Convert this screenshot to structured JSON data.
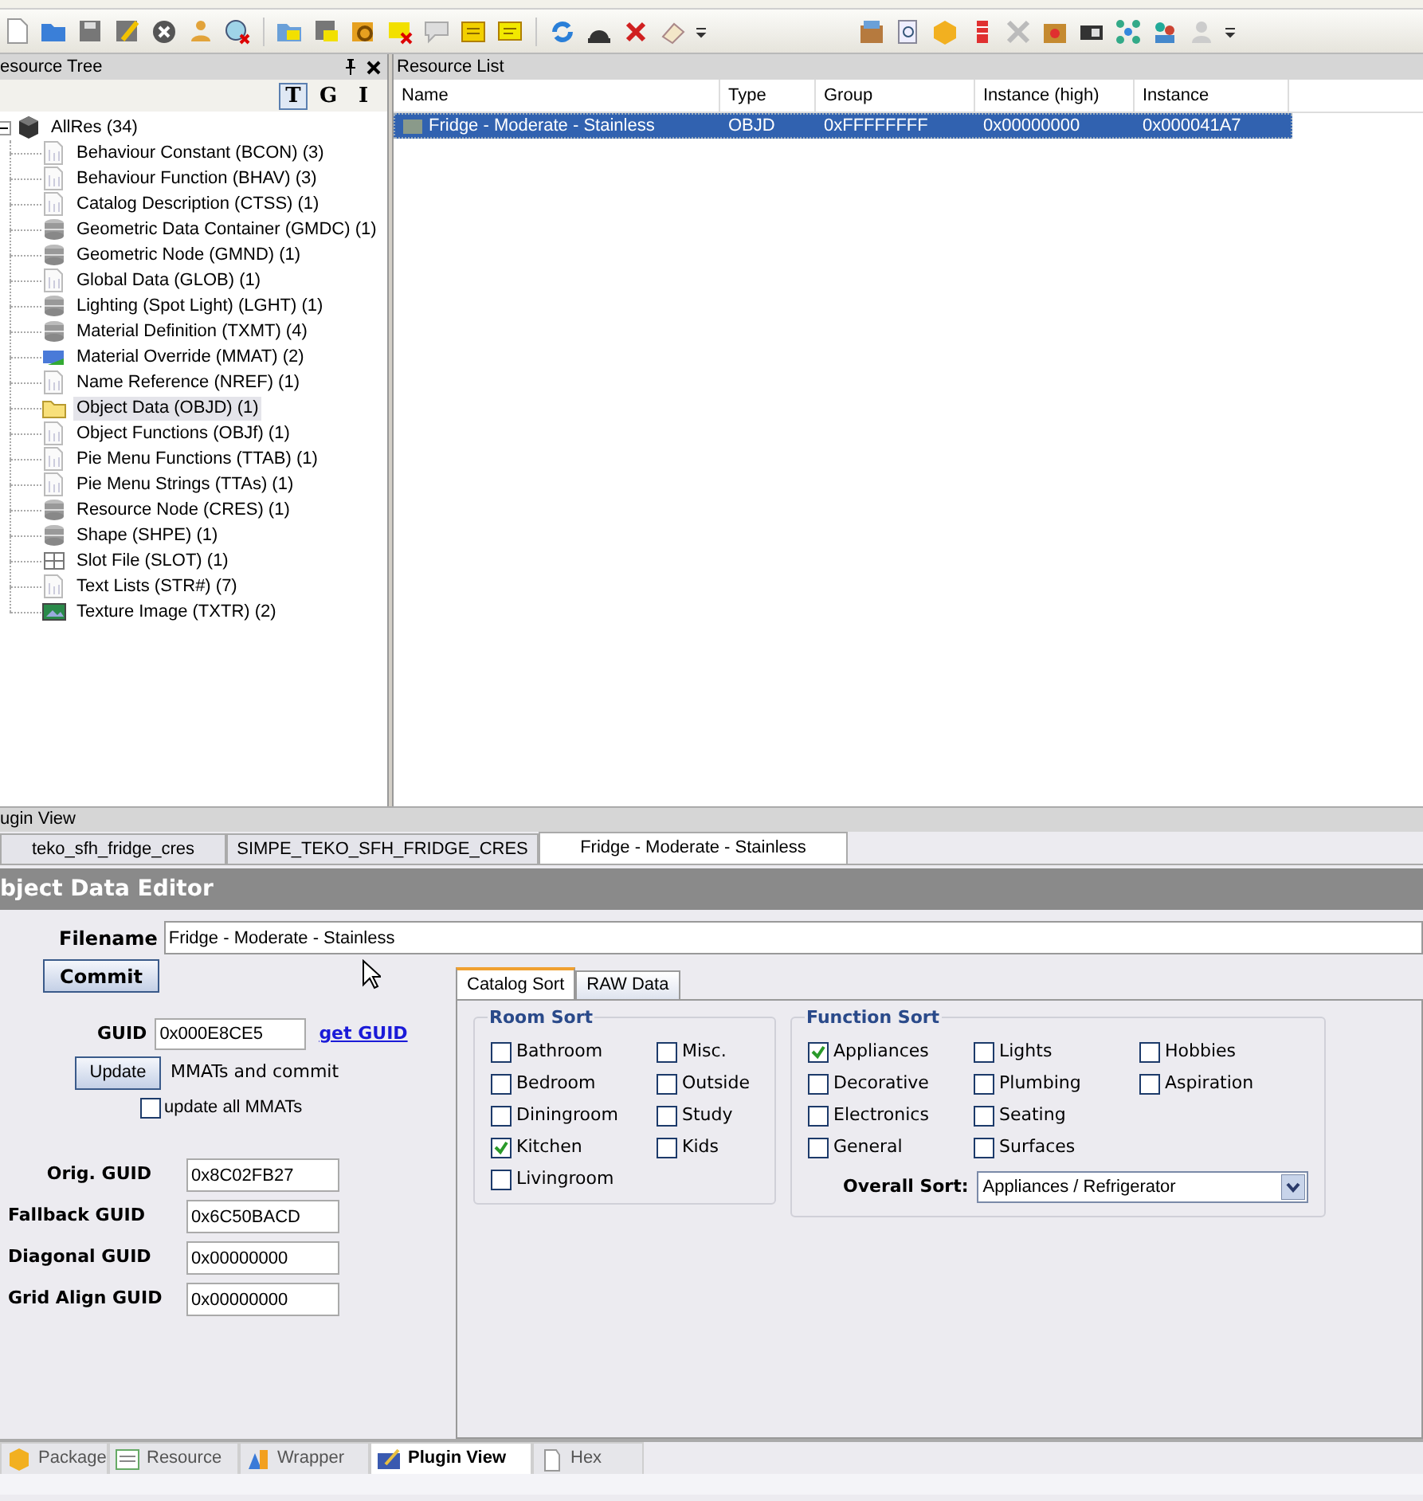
{
  "resource_tree": {
    "title": "esource Tree",
    "view_buttons": [
      {
        "label": "T",
        "selected": true
      },
      {
        "label": "G",
        "selected": false
      },
      {
        "label": "I",
        "selected": false
      }
    ],
    "root": {
      "label": "AllRes (34)",
      "expanded": true,
      "children": [
        {
          "label": "Behaviour Constant (BCON) (3)",
          "kind": "doc",
          "selected": false
        },
        {
          "label": "Behaviour Function (BHAV) (3)",
          "kind": "doc",
          "selected": false
        },
        {
          "label": "Catalog Description (CTSS) (1)",
          "kind": "doc",
          "selected": false
        },
        {
          "label": "Geometric Data Container (GMDC) (1)",
          "kind": "db",
          "selected": false
        },
        {
          "label": "Geometric Node (GMND) (1)",
          "kind": "db",
          "selected": false
        },
        {
          "label": "Global Data (GLOB) (1)",
          "kind": "doc",
          "selected": false
        },
        {
          "label": "Lighting (Spot Light) (LGHT) (1)",
          "kind": "db",
          "selected": false
        },
        {
          "label": "Material Definition (TXMT) (4)",
          "kind": "db",
          "selected": false
        },
        {
          "label": "Material Override (MMAT) (2)",
          "kind": "material",
          "selected": false
        },
        {
          "label": "Name Reference (NREF) (1)",
          "kind": "doc",
          "selected": false
        },
        {
          "label": "Object Data (OBJD) (1)",
          "kind": "folder",
          "selected": true
        },
        {
          "label": "Object Functions (OBJf) (1)",
          "kind": "doc",
          "selected": false
        },
        {
          "label": "Pie Menu Functions (TTAB) (1)",
          "kind": "doc",
          "selected": false
        },
        {
          "label": "Pie Menu Strings (TTAs) (1)",
          "kind": "doc",
          "selected": false
        },
        {
          "label": "Resource Node (CRES) (1)",
          "kind": "db",
          "selected": false
        },
        {
          "label": "Shape (SHPE) (1)",
          "kind": "db",
          "selected": false
        },
        {
          "label": "Slot File (SLOT) (1)",
          "kind": "slot",
          "selected": false
        },
        {
          "label": "Text Lists (STR#) (7)",
          "kind": "doc",
          "selected": false
        },
        {
          "label": "Texture Image (TXTR) (2)",
          "kind": "image",
          "selected": false
        }
      ]
    }
  },
  "resource_list": {
    "title": "Resource List",
    "columns": [
      "Name",
      "Type",
      "Group",
      "Instance (high)",
      "Instance"
    ],
    "rows": [
      {
        "cells": [
          "Fridge - Moderate - Stainless",
          "OBJD",
          "0xFFFFFFFF",
          "0x00000000",
          "0x000041A7"
        ],
        "selected": true
      }
    ]
  },
  "plugin_view": {
    "title": "ugin View",
    "doc_tabs": [
      {
        "label": "teko_sfh_fridge_cres",
        "selected": false
      },
      {
        "label": "SIMPE_TEKO_SFH_FRIDGE_CRES",
        "selected": false
      },
      {
        "label": "Fridge - Moderate - Stainless",
        "selected": true
      }
    ],
    "editor": {
      "title": "bject Data Editor",
      "filename_label": "Filename",
      "filename": "Fridge - Moderate - Stainless",
      "commit": "Commit",
      "guid_label": "GUID",
      "guid": "0x000E8CE5",
      "get_guid": "get GUID",
      "update": "Update",
      "update_text": "MMATs and commit",
      "update_all": {
        "label": "update all MMATs",
        "checked": false
      },
      "guids": [
        {
          "label": "Orig. GUID",
          "value": "0x8C02FB27"
        },
        {
          "label": "Fallback GUID",
          "value": "0x6C50BACD"
        },
        {
          "label": "Diagonal GUID",
          "value": "0x00000000"
        },
        {
          "label": "Grid Align GUID",
          "value": "0x00000000"
        }
      ],
      "tabs": [
        {
          "label": "Catalog Sort",
          "selected": true
        },
        {
          "label": "RAW Data",
          "selected": false
        }
      ],
      "room_sort": {
        "title": "Room Sort",
        "columns": [
          [
            {
              "label": "Bathroom",
              "checked": false
            },
            {
              "label": "Bedroom",
              "checked": false
            },
            {
              "label": "Diningroom",
              "checked": false
            },
            {
              "label": "Kitchen",
              "checked": true
            },
            {
              "label": "Livingroom",
              "checked": false
            }
          ],
          [
            {
              "label": "Misc.",
              "checked": false
            },
            {
              "label": "Outside",
              "checked": false
            },
            {
              "label": "Study",
              "checked": false
            },
            {
              "label": "Kids",
              "checked": false
            }
          ]
        ]
      },
      "function_sort": {
        "title": "Function Sort",
        "columns": [
          [
            {
              "label": "Appliances",
              "checked": true
            },
            {
              "label": "Decorative",
              "checked": false
            },
            {
              "label": "Electronics",
              "checked": false
            },
            {
              "label": "General",
              "checked": false
            }
          ],
          [
            {
              "label": "Lights",
              "checked": false
            },
            {
              "label": "Plumbing",
              "checked": false
            },
            {
              "label": "Seating",
              "checked": false
            },
            {
              "label": "Surfaces",
              "checked": false
            }
          ],
          [
            {
              "label": "Hobbies",
              "checked": false
            },
            {
              "label": "Aspiration",
              "checked": false
            }
          ]
        ],
        "overall_label": "Overall Sort:",
        "overall": "Appliances / Refrigerator"
      }
    }
  },
  "bottom_tabs": [
    {
      "label": "Package",
      "selected": false
    },
    {
      "label": "Resource",
      "selected": false
    },
    {
      "label": "Wrapper",
      "selected": false
    },
    {
      "label": "Plugin View",
      "selected": true
    },
    {
      "label": "Hex",
      "selected": false
    }
  ]
}
